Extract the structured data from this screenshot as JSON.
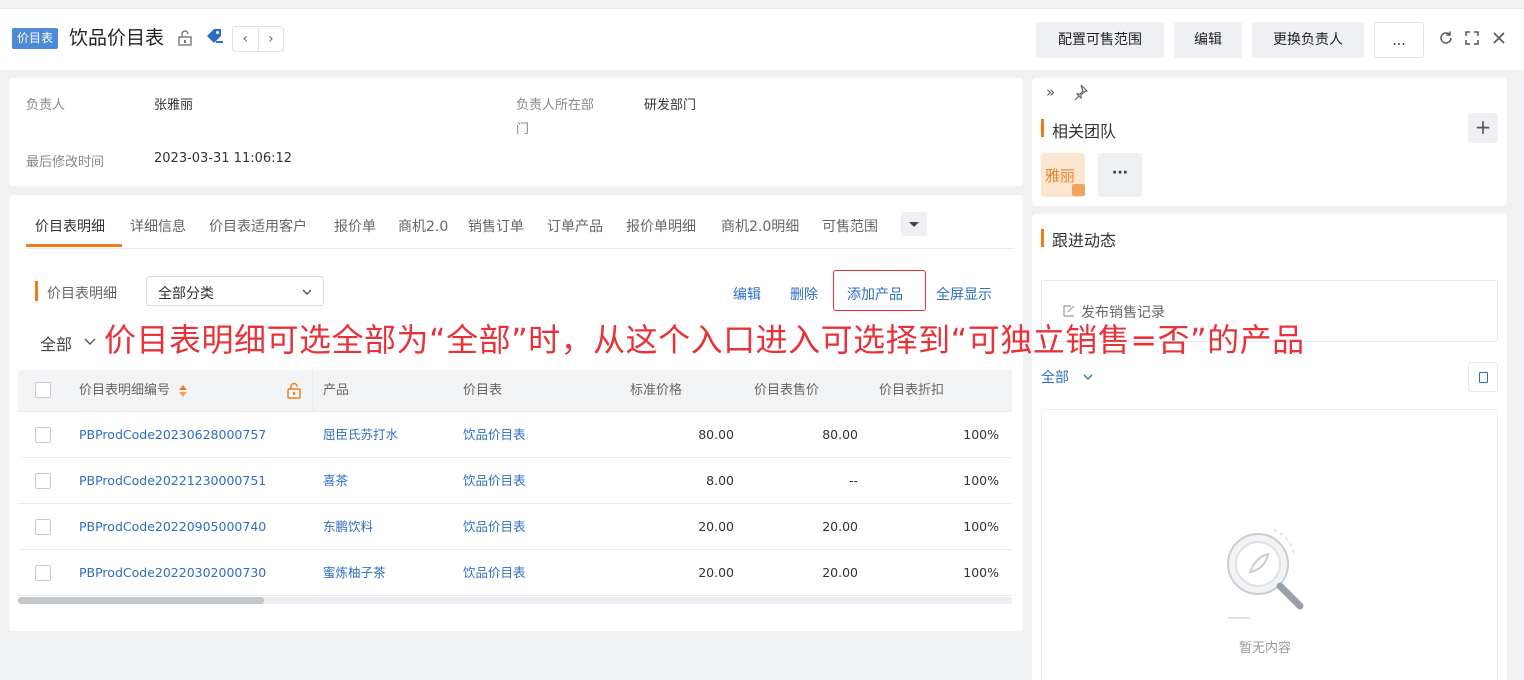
{
  "header": {
    "tag": "价目表",
    "title": "饮品价目表",
    "buttons": [
      "配置可售范围",
      "编辑",
      "更换负责人",
      "..."
    ]
  },
  "info": {
    "owner_label": "负责人",
    "owner_value": "张雅丽",
    "dept_label_line1": "负责人所在部",
    "dept_label_line2": "门",
    "dept_value": "研发部门",
    "modified_label": "最后修改时间",
    "modified_value": "2023-03-31 11:06:12"
  },
  "tabs": [
    "价目表明细",
    "详细信息",
    "价目表适用客户",
    "报价单",
    "商机2.0",
    "销售订单",
    "订单产品",
    "报价单明细",
    "商机2.0明细",
    "可售范围"
  ],
  "detail": {
    "section_label": "价目表明细",
    "filter_value": "全部分类",
    "actions": [
      "编辑",
      "删除",
      "添加产品",
      "全屏显示"
    ],
    "scope_label": "全部"
  },
  "annotation": "价目表明细可选全部为“全部”时，从这个入口进入可选择到“可独立销售=否”的产品",
  "table": {
    "columns": [
      "价目表明细编号",
      "产品",
      "价目表",
      "标准价格",
      "价目表售价",
      "价目表折扣"
    ],
    "rows": [
      [
        "PBProdCode20230628000757",
        "屈臣氏苏打水",
        "饮品价目表",
        "80.00",
        "80.00",
        "100%"
      ],
      [
        "PBProdCode20221230000751",
        "喜茶",
        "饮品价目表",
        "8.00",
        "--",
        "100%"
      ],
      [
        "PBProdCode20220905000740",
        "东鹏饮料",
        "饮品价目表",
        "20.00",
        "20.00",
        "100%"
      ],
      [
        "PBProdCode20220302000730",
        "蜜炼柚子茶",
        "饮品价目表",
        "20.00",
        "20.00",
        "100%"
      ]
    ]
  },
  "sidebar": {
    "team_title": "相关团队",
    "member_name": "雅丽",
    "followup_title": "跟进动态",
    "post_label": "发布销售记录",
    "scope": "全部",
    "empty_text": "暂无内容"
  },
  "colors": {
    "accent": "#f07d1c",
    "link": "#2e6ec2",
    "annotation": "#e8323a",
    "tag": "#4d8ad8"
  }
}
